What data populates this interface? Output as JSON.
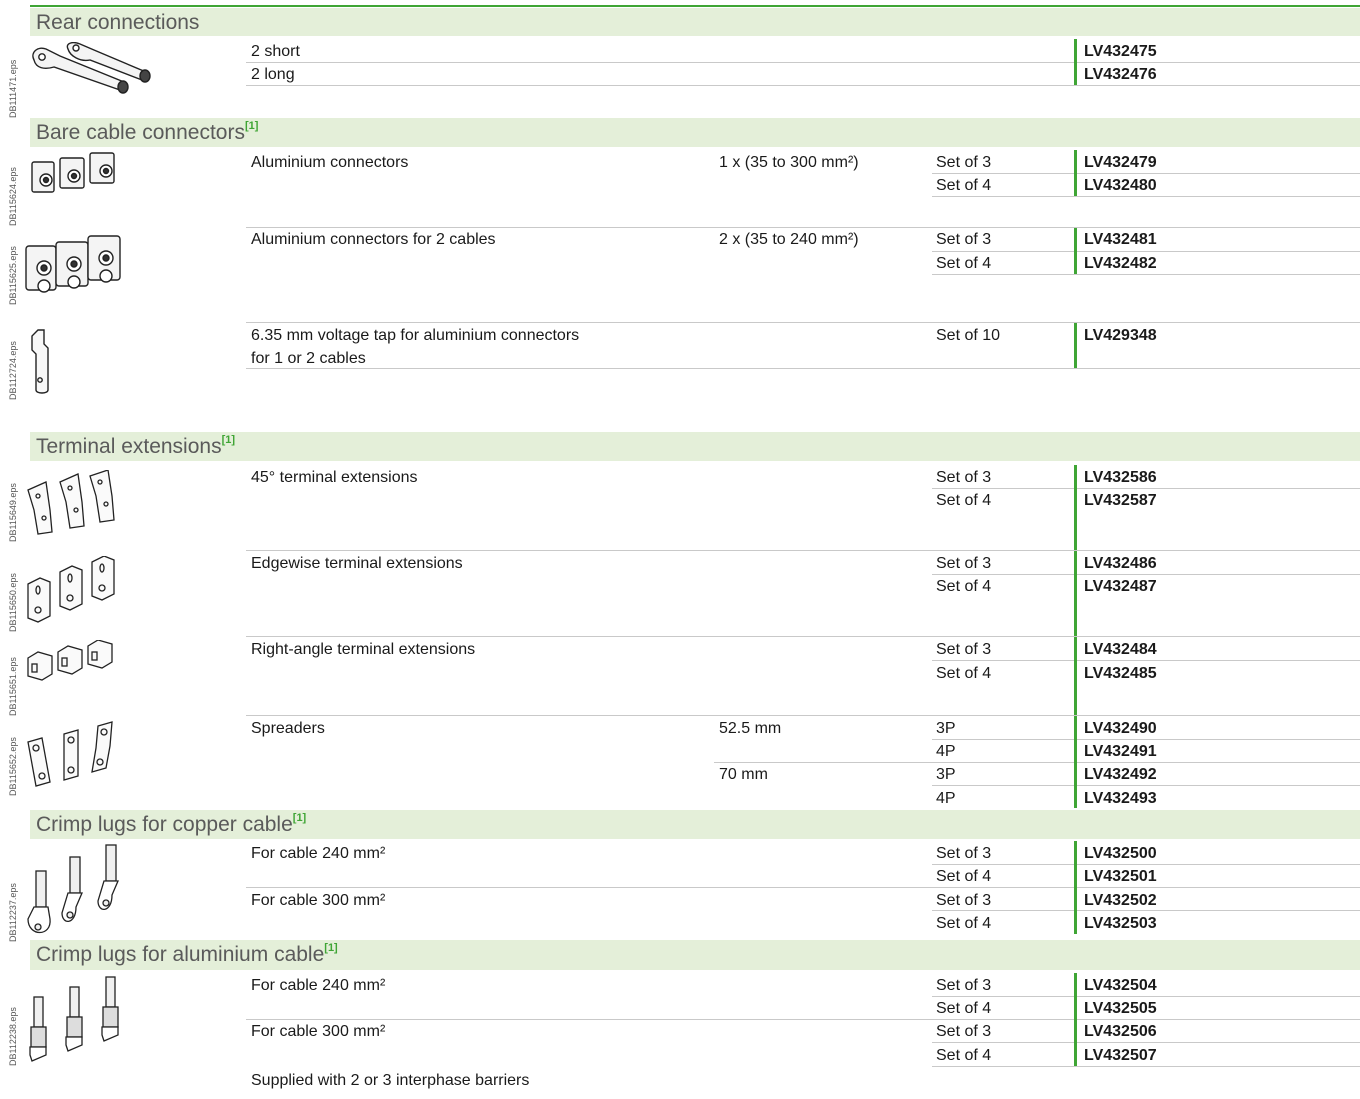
{
  "sections": [
    {
      "title": "Rear connections",
      "note": ""
    },
    {
      "title": "Bare cable connectors",
      "note": "[1]"
    },
    {
      "title": "Terminal extensions",
      "note": "[1]"
    },
    {
      "title": "Crimp lugs for copper cable",
      "note": "[1]"
    },
    {
      "title": "Crimp lugs for aluminium cable",
      "note": "[1]"
    }
  ],
  "image_labels": [
    "DB111471.eps",
    "DB115624.eps",
    "DB115625.eps",
    "DB112724.eps",
    "DB115649.eps",
    "DB115650.eps",
    "DB115651.eps",
    "DB115652.eps",
    "DB112237.eps",
    "DB112238.eps"
  ],
  "descriptions": [
    "2 short",
    "2 long",
    "Aluminium connectors",
    "Aluminium connectors for 2 cables",
    "6.35 mm voltage tap for aluminium connectors",
    "for 1 or 2 cables",
    "45° terminal extensions",
    "Edgewise terminal extensions",
    "Right-angle terminal extensions",
    "Spreaders",
    "For cable 240 mm²",
    "For cable 300 mm²",
    "For cable 240 mm²",
    "For cable 300 mm²"
  ],
  "specs": [
    "1 x (35 to 300 mm²)",
    "2 x (35 to 240 mm²)",
    "52.5 mm",
    "70 mm"
  ],
  "quantities": [
    "Set of 3",
    "Set of 4",
    "Set of 3",
    "Set of 4",
    "Set of 10",
    "Set of 3",
    "Set of 4",
    "Set of 3",
    "Set of 4",
    "Set of 3",
    "Set of 4",
    "3P",
    "4P",
    "3P",
    "4P",
    "Set of 3",
    "Set of 4",
    "Set of 3",
    "Set of 4",
    "Set of 3",
    "Set of 4",
    "Set of 3",
    "Set of 4"
  ],
  "references": [
    "LV432475",
    "LV432476",
    "LV432479",
    "LV432480",
    "LV432481",
    "LV432482",
    "LV429348",
    "LV432586",
    "LV432587",
    "LV432486",
    "LV432487",
    "LV432484",
    "LV432485",
    "LV432490",
    "LV432491",
    "LV432492",
    "LV432493",
    "LV432500",
    "LV432501",
    "LV432502",
    "LV432503",
    "LV432504",
    "LV432505",
    "LV432506",
    "LV432507"
  ],
  "footer_note": "Supplied with 2 or 3 interphase barriers",
  "colors": {
    "accent": "#3fa535",
    "band": "#e4efd9"
  }
}
